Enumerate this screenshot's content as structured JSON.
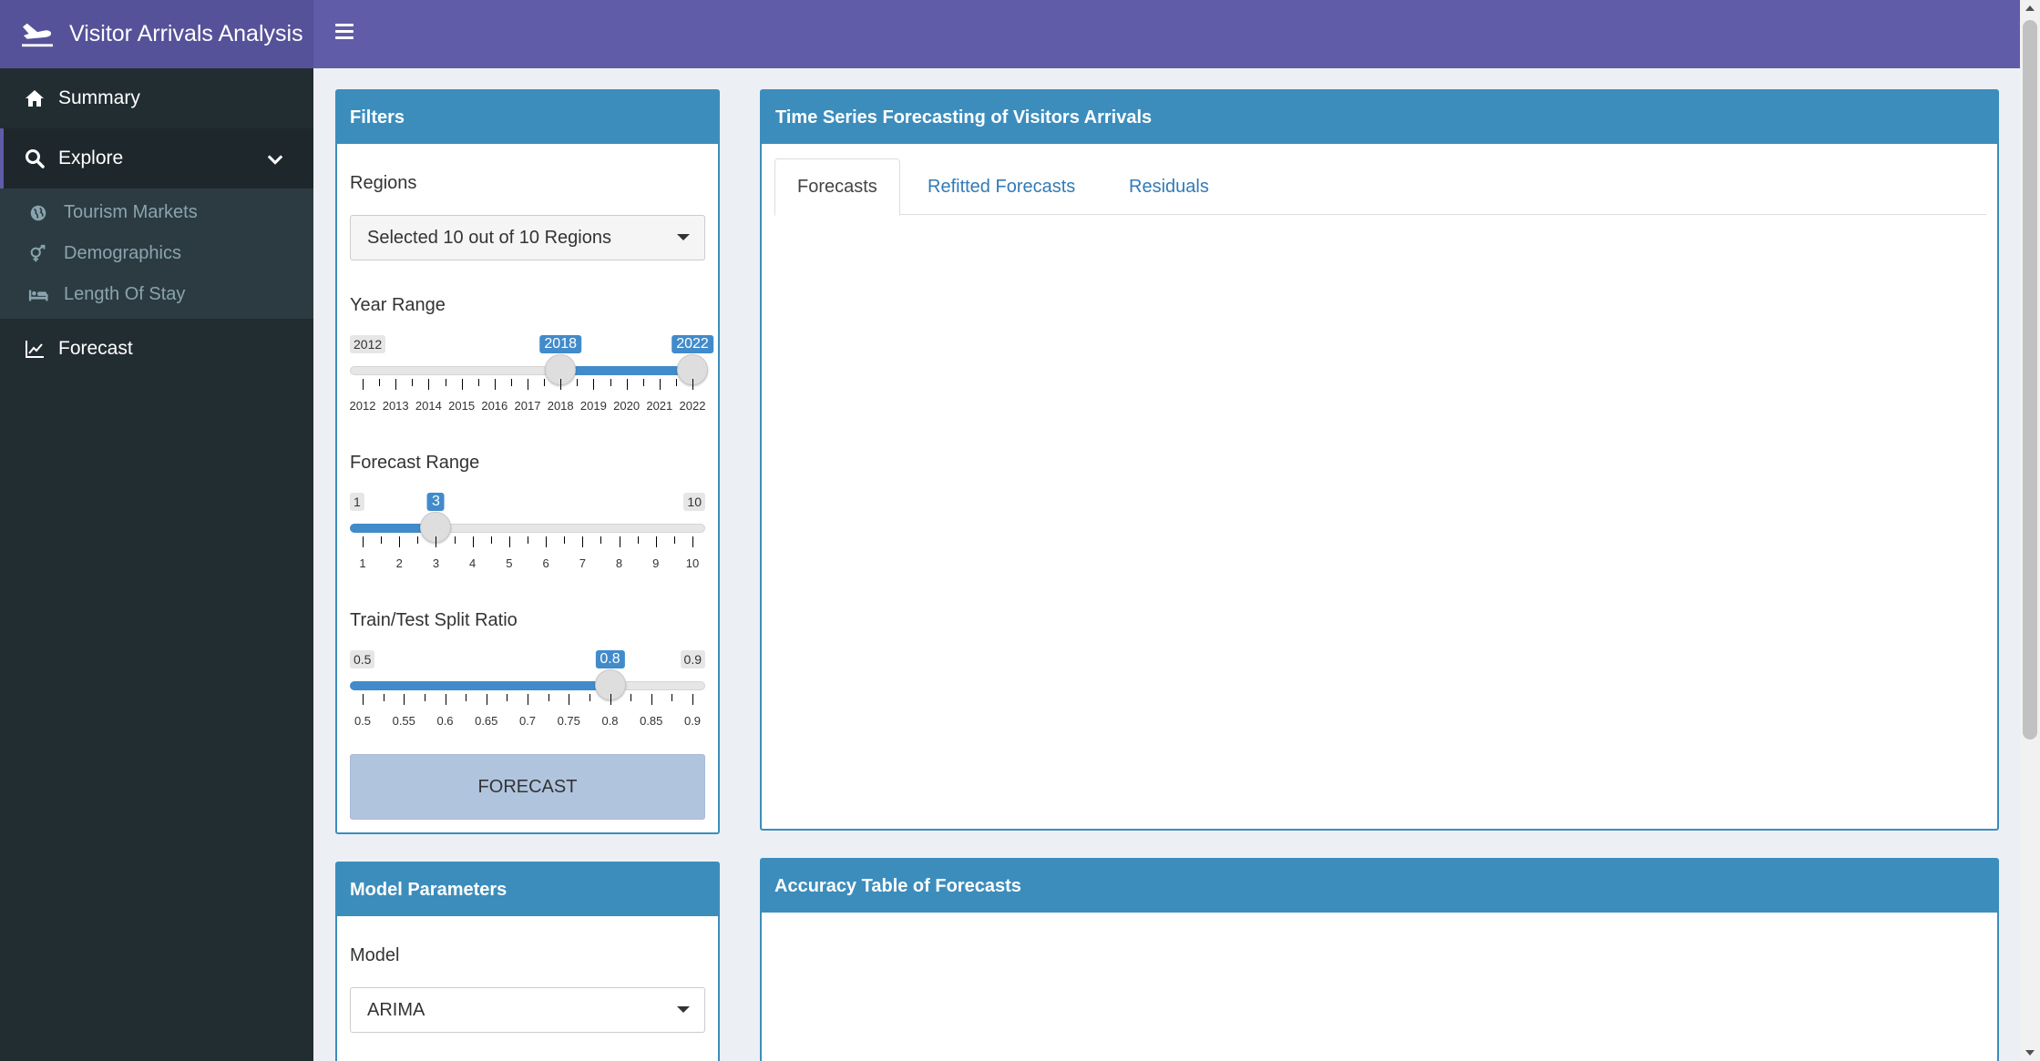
{
  "header": {
    "app_title": "Visitor Arrivals Analysis",
    "brand_color": "#605ca8"
  },
  "sidebar": {
    "items": [
      {
        "label": "Summary",
        "icon": "home-icon"
      },
      {
        "label": "Explore",
        "icon": "search-icon",
        "expanded": true
      },
      {
        "label": "Forecast",
        "icon": "line-chart-icon"
      }
    ],
    "explore_subitems": [
      {
        "label": "Tourism Markets",
        "icon": "globe-icon"
      },
      {
        "label": "Demographics",
        "icon": "venus-mars-icon"
      },
      {
        "label": "Length Of Stay",
        "icon": "bed-icon"
      }
    ]
  },
  "filters": {
    "title": "Filters",
    "regions_label": "Regions",
    "regions_value": "Selected 10 out of 10 Regions",
    "year_range": {
      "label": "Year Range",
      "min": 2012,
      "max": 2022,
      "from": 2018,
      "to": 2022,
      "min_label": "2012",
      "from_label": "2018",
      "to_label": "2022",
      "ticks": [
        "2012",
        "2013",
        "2014",
        "2015",
        "2016",
        "2017",
        "2018",
        "2019",
        "2020",
        "2021",
        "2022"
      ]
    },
    "forecast_range": {
      "label": "Forecast Range",
      "min": 1,
      "max": 10,
      "value": 3,
      "min_label": "1",
      "value_label": "3",
      "max_label": "10",
      "ticks": [
        "1",
        "2",
        "3",
        "4",
        "5",
        "6",
        "7",
        "8",
        "9",
        "10"
      ]
    },
    "split_ratio": {
      "label": "Train/Test Split Ratio",
      "min": 0.5,
      "max": 0.9,
      "value": 0.8,
      "min_label": "0.5",
      "value_label": "0.8",
      "max_label": "0.9",
      "ticks": [
        "0.5",
        "0.55",
        "0.6",
        "0.65",
        "0.7",
        "0.75",
        "0.8",
        "0.85",
        "0.9"
      ]
    },
    "forecast_button": "FORECAST"
  },
  "model_params": {
    "title": "Model Parameters",
    "model_label": "Model",
    "model_value": "ARIMA"
  },
  "forecast_panel": {
    "title": "Time Series Forecasting of Visitors Arrivals",
    "tabs": [
      "Forecasts",
      "Refitted Forecasts",
      "Residuals"
    ],
    "active_tab": "Forecasts"
  },
  "accuracy_panel": {
    "title": "Accuracy Table of Forecasts"
  }
}
